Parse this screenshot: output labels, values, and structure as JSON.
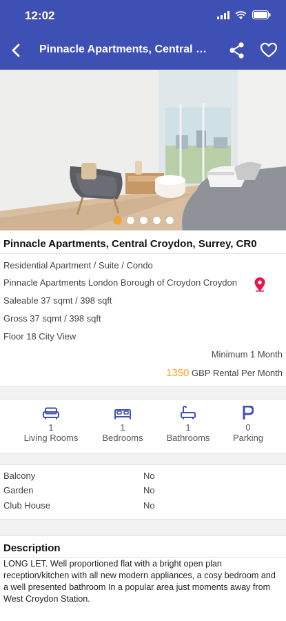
{
  "status_bar": {
    "time": "12:02"
  },
  "header": {
    "title": "Pinnacle Apartments, Central Croydon, Surrey, CR0"
  },
  "gallery": {
    "dot_count": 5,
    "active_index": 0
  },
  "listing": {
    "title": "Pinnacle Apartments, Central Croydon, Surrey, CR0",
    "type": "Residential Apartment / Suite / Condo",
    "address": "Pinnacle Apartments London Borough of Croydon Croydon",
    "saleable": "Saleable 37 sqmt / 398 sqft",
    "gross": "Gross 37 sqmt / 398 sqft",
    "floor": "Floor 18 City View",
    "minimum": "Minimum 1 Month",
    "price_amount": "1350",
    "price_unit": " GBP Rental Per Month"
  },
  "features": [
    {
      "icon": "sofa-icon",
      "count": "1",
      "label": "Living Rooms"
    },
    {
      "icon": "bed-icon",
      "count": "1",
      "label": "Bedrooms"
    },
    {
      "icon": "bathtub-icon",
      "count": "1",
      "label": "Bathrooms"
    },
    {
      "icon": "parking-icon",
      "count": "0",
      "label": "Parking"
    }
  ],
  "amenities": [
    {
      "name": "Balcony",
      "value": "No"
    },
    {
      "name": "Garden",
      "value": "No"
    },
    {
      "name": "Club House",
      "value": "No"
    }
  ],
  "description": {
    "heading": "Description",
    "text": "LONG LET. Well proportioned flat with a bright open plan reception/kitchen with all new modern appliances, a cosy bedroom and a well presented bathroom In a popular area just moments away from West Croydon Station."
  },
  "colors": {
    "accent": "#3f50b5",
    "price": "#f5a623",
    "pin": "#e8134f"
  }
}
